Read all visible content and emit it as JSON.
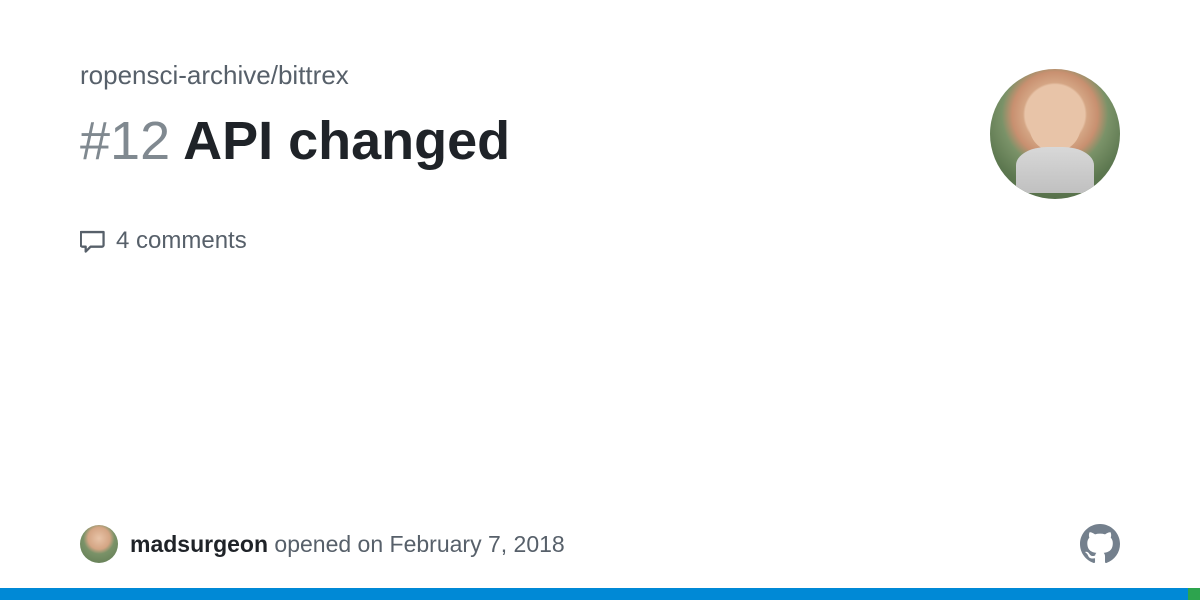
{
  "repo": {
    "path": "ropensci-archive/bittrex"
  },
  "issue": {
    "number": "#12",
    "title": "API changed",
    "comments_text": "4 comments"
  },
  "author": {
    "username": "madsurgeon",
    "action": "opened on",
    "date": "February 7, 2018"
  }
}
